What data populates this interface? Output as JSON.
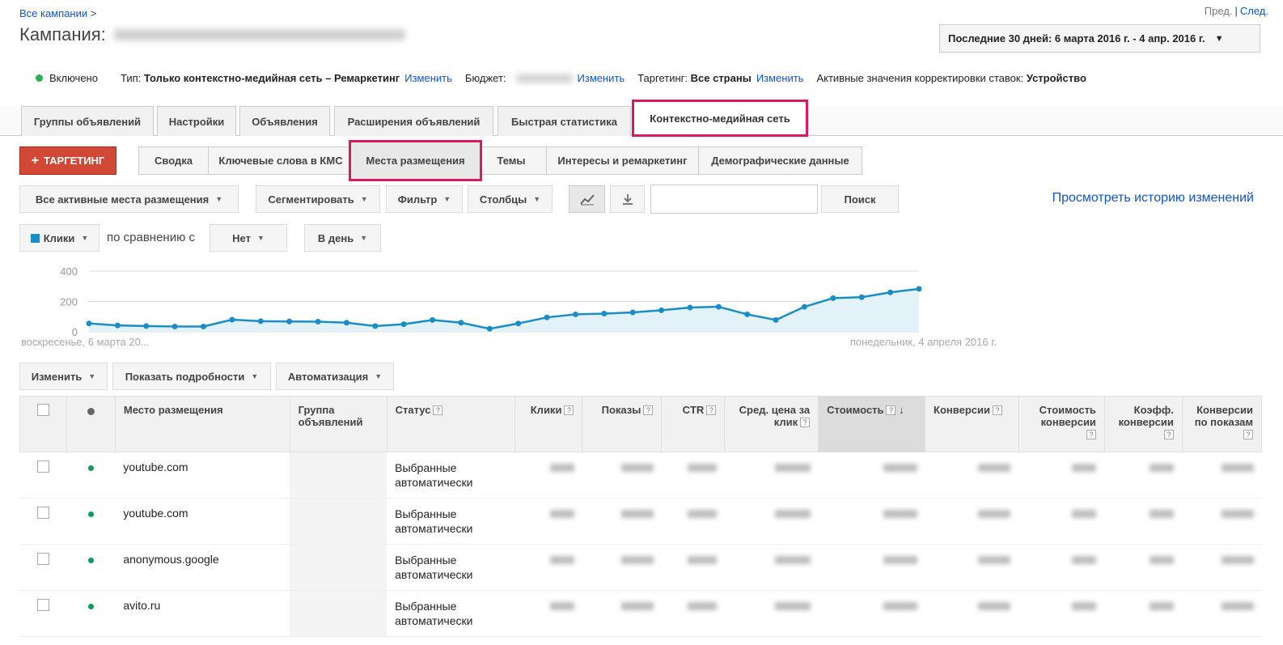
{
  "breadcrumb": {
    "all_campaigns": "Все кампании",
    "separator": ">"
  },
  "pager": {
    "prev": "Пред.",
    "divider": "|",
    "next": "След."
  },
  "campaign": {
    "prefix": "Кампания:"
  },
  "date_range": {
    "label": "Последние 30 дней: 6 марта 2016 г. - 4 апр. 2016 г."
  },
  "status_line": {
    "enabled": "Включено",
    "type_label": "Тип:",
    "type_value": "Только контекстно-медийная сеть – Ремаркетинг",
    "change": "Изменить",
    "budget_label": "Бюджет:",
    "targeting_label": "Таргетинг:",
    "targeting_value": "Все страны",
    "bid_adj_label": "Активные значения корректировки ставок:",
    "bid_adj_value": "Устройство"
  },
  "main_tabs": [
    {
      "label": "Группы объявлений"
    },
    {
      "label": "Настройки"
    },
    {
      "label": "Объявления"
    },
    {
      "label": "Расширения объявлений"
    },
    {
      "label": "Быстрая статистика"
    },
    {
      "label": "Контекстно-медийная сеть"
    }
  ],
  "targeting_button": {
    "plus": "+",
    "label": "ТАРГЕТИНГ"
  },
  "sub_tabs": [
    {
      "label": "Сводка"
    },
    {
      "label": "Ключевые слова в КМС"
    },
    {
      "label": "Места размещения"
    },
    {
      "label": "Темы"
    },
    {
      "label": "Интересы и ремаркетинг"
    },
    {
      "label": "Демографические данные"
    }
  ],
  "toolbar": {
    "filter_all": "Все активные места размещения",
    "segment": "Сегментировать",
    "filter": "Фильтр",
    "columns": "Столбцы",
    "search_button": "Поиск",
    "history_link": "Просмотреть историю изменений"
  },
  "chart_controls": {
    "metric": "Клики",
    "compare_text": "по сравнению с",
    "compare_value": "Нет",
    "period": "В день"
  },
  "chart_data": {
    "type": "area",
    "yticks": [
      0,
      200,
      400
    ],
    "ylim": [
      0,
      400
    ],
    "x_start_label": "воскресенье, 6 марта 20...",
    "x_end_label": "понедельник, 4 апреля 2016 г.",
    "color": "#1a8dc7",
    "values": [
      55,
      42,
      38,
      35,
      35,
      80,
      70,
      68,
      67,
      60,
      38,
      50,
      78,
      60,
      20,
      55,
      95,
      115,
      120,
      128,
      142,
      160,
      165,
      115,
      78,
      165,
      222,
      228,
      260,
      283
    ]
  },
  "table_actions": {
    "edit": "Изменить",
    "details": "Показать подробности",
    "automation": "Автоматизация"
  },
  "table": {
    "headers": {
      "placement": "Место размещения",
      "group": "Группа объявлений",
      "status": "Статус",
      "clicks": "Клики",
      "impressions": "Показы",
      "ctr": "CTR",
      "avg_cpc": "Сред. цена за клик",
      "cost": "Стоимость",
      "conversions": "Конверсии",
      "cost_per_conv": "Стоимость конверсии",
      "conv_rate": "Коэфф. конверсии",
      "view_conv": "Конверсии по показам"
    },
    "help": "?",
    "sort_arrow": "↓",
    "rows": [
      {
        "placement": "youtube.com",
        "status": "Выбранные автоматически"
      },
      {
        "placement": "youtube.com",
        "status": "Выбранные автоматически"
      },
      {
        "placement": "anonymous.google",
        "status": "Выбранные автоматически"
      },
      {
        "placement": "avito.ru",
        "status": "Выбранные автоматически"
      }
    ]
  }
}
